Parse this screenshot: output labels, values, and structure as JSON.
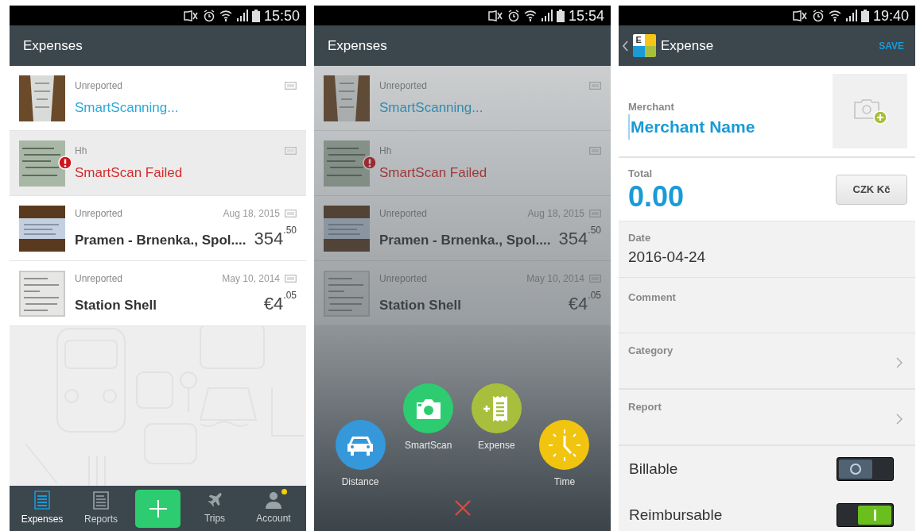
{
  "screens": [
    {
      "status_bar": {
        "time": "15:50"
      },
      "app_bar": {
        "title": "Expenses"
      },
      "expenses": [
        {
          "status": "Unreported",
          "merchant": "SmartScanning...",
          "kind": "scanning",
          "selected": false,
          "error": false
        },
        {
          "status": "Hh",
          "merchant": "SmartScan Failed",
          "kind": "failed",
          "selected": true,
          "error": true
        },
        {
          "status": "Unreported",
          "merchant": "Pramen - Brnenka., Spol....",
          "kind": "done",
          "date": "Aug 18, 2015",
          "amount": "354$^{.50}$",
          "selected": false,
          "error": false
        },
        {
          "status": "Unreported",
          "merchant": "Station Shell",
          "kind": "done",
          "date": "May 10, 2014",
          "amount": "€4$^{.05}$",
          "selected": false,
          "error": false
        }
      ],
      "bottom_nav": [
        {
          "kind": "tab",
          "label": "Expenses",
          "selected": true,
          "notification": false
        },
        {
          "kind": "tab",
          "label": "Reports",
          "selected": false,
          "notification": false
        },
        {
          "kind": "add"
        },
        {
          "kind": "tab",
          "label": "Trips",
          "selected": false,
          "notification": false
        },
        {
          "kind": "tab",
          "label": "Account",
          "selected": false,
          "notification": true
        }
      ]
    },
    {
      "status_bar": {
        "time": "15:54"
      },
      "app_bar": {
        "title": "Expenses"
      },
      "expenses": [
        {
          "status": "Unreported",
          "merchant": "SmartScanning...",
          "kind": "scanning",
          "error": false
        },
        {
          "status": "Hh",
          "merchant": "SmartScan Failed",
          "kind": "failed",
          "error": true
        },
        {
          "status": "Unreported",
          "merchant": "Pramen - Brnenka., Spol....",
          "kind": "done",
          "date": "Aug 18, 2015",
          "amount": "354$^{.50}$",
          "error": false
        },
        {
          "status": "Unreported",
          "merchant": "Station Shell",
          "kind": "done",
          "date": "May 10, 2014",
          "amount": "€4$^{.05}$",
          "error": false
        }
      ],
      "add_menu": {
        "items": [
          {
            "label": "Distance",
            "kind": "car",
            "color": "#3498db"
          },
          {
            "label": "SmartScan",
            "kind": "camera",
            "color": "#2ecc71"
          },
          {
            "label": "Expense",
            "kind": "receipt",
            "color": "#a8bf3d"
          },
          {
            "label": "Time",
            "kind": "clock",
            "color": "#f1c40f"
          }
        ]
      }
    },
    {
      "status_bar": {
        "time": "19:40"
      },
      "app_bar": {
        "title": "Expense",
        "logo_letter": "E",
        "action": "SAVE"
      },
      "form": {
        "merchant": {
          "label": "Merchant",
          "value": "Merchant Name"
        },
        "total": {
          "label": "Total",
          "value": "0.00",
          "currency": "CZK Kč"
        },
        "date": {
          "label": "Date",
          "value": "2016-04-24"
        },
        "comment": {
          "label": "Comment"
        },
        "links": [
          {
            "label": "Category"
          },
          {
            "label": "Report"
          }
        ],
        "toggles": [
          {
            "label": "Billable",
            "on": false
          },
          {
            "label": "Reimbursable",
            "on": true
          }
        ]
      }
    }
  ]
}
